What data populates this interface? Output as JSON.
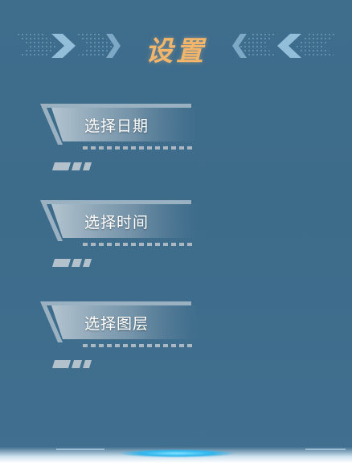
{
  "header": {
    "title": "设置",
    "title_color": "#f3b56a",
    "left_decoration": "chevron-arrows-right-icon",
    "right_decoration": "chevron-arrows-left-icon"
  },
  "menu": {
    "items": [
      {
        "label": "选择日期",
        "icon": "tab-frame"
      },
      {
        "label": "选择时间",
        "icon": "tab-frame"
      },
      {
        "label": "选择图层",
        "icon": "tab-frame"
      }
    ]
  },
  "colors": {
    "background": "#3f6d8c",
    "accent_glow": "#2fb5ec"
  }
}
